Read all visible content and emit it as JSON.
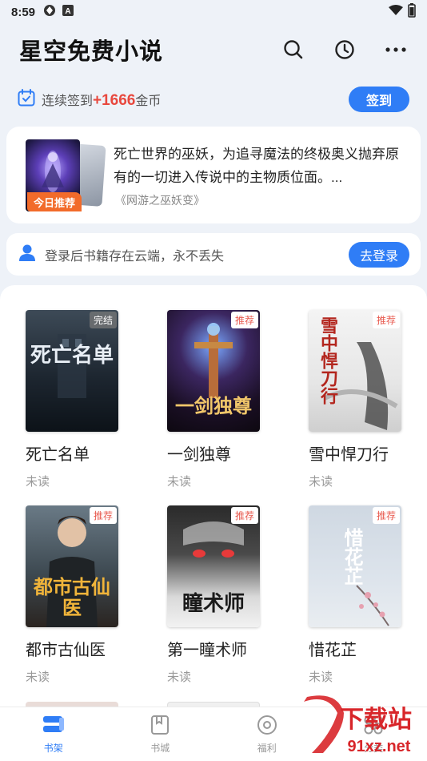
{
  "status_bar": {
    "time": "8:59"
  },
  "header": {
    "title": "星空免费小说",
    "icons": [
      "search-icon",
      "history-clock-icon",
      "more-icon"
    ]
  },
  "checkin": {
    "prefix": "连续签到",
    "bonus": "+1666",
    "suffix": "金币",
    "button": "签到"
  },
  "recommend": {
    "badge": "今日推荐",
    "description": "死亡世界的巫妖，为追寻魔法的终极奥义抛弃原有的一切进入传说中的主物质位面。...",
    "book_title": "《网游之巫妖变》"
  },
  "login": {
    "text": "登录后书籍存在云端，永不丢失",
    "button": "去登录"
  },
  "books": [
    {
      "name": "死亡名单",
      "status": "未读",
      "tag": "完结",
      "cover_text": "死亡名单"
    },
    {
      "name": "一剑独尊",
      "status": "未读",
      "tag": "推荐",
      "cover_text": "一剑独尊"
    },
    {
      "name": "雪中悍刀行",
      "status": "未读",
      "tag": "推荐",
      "cover_text": "雪中悍刀行"
    },
    {
      "name": "都市古仙医",
      "status": "未读",
      "tag": "推荐",
      "cover_text": "都市古仙医"
    },
    {
      "name": "第一瞳术师",
      "status": "未读",
      "tag": "推荐",
      "cover_text": "瞳术师"
    },
    {
      "name": "惜花芷",
      "status": "未读",
      "tag": "推荐",
      "cover_text": "惜花芷"
    }
  ],
  "bottom_nav": [
    {
      "label": "书架",
      "icon": "bookshelf-icon",
      "active": true
    },
    {
      "label": "书城",
      "icon": "book-icon",
      "active": false
    },
    {
      "label": "福利",
      "icon": "gift-circle-icon",
      "active": false
    },
    {
      "label": "分类",
      "icon": "category-grid-icon",
      "active": false
    }
  ],
  "watermark": {
    "text": "下载站",
    "url": "91xz.net"
  },
  "colors": {
    "accent": "#2f7df6",
    "bonus": "#e8483e",
    "badge": "#f26b2a"
  }
}
